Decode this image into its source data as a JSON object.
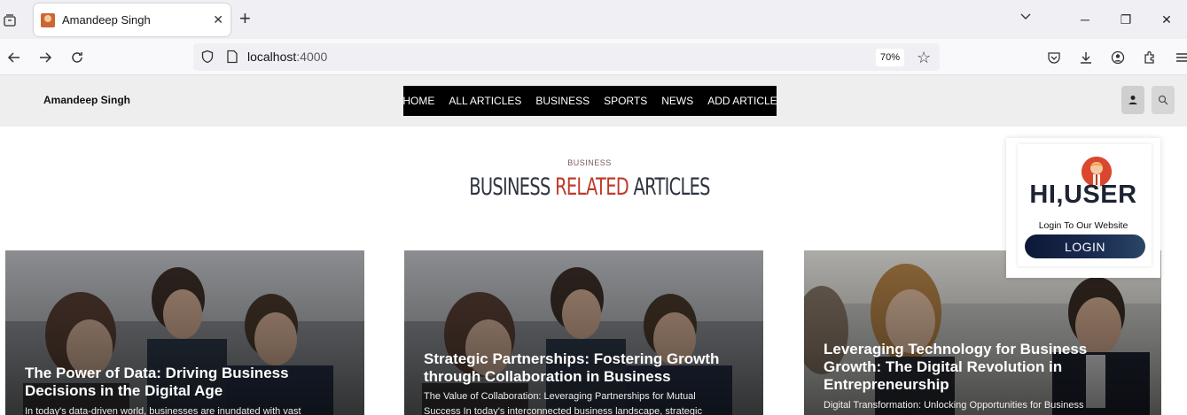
{
  "browser": {
    "tab_title": "Amandeep Singh",
    "url_host": "localhost",
    "url_port": ":4000",
    "zoom": "70%"
  },
  "site": {
    "brand": "Amandeep Singh",
    "nav": [
      "HOME",
      "ALL ARTICLES",
      "BUSINESS",
      "SPORTS",
      "NEWS",
      "ADD ARTICLE"
    ]
  },
  "section": {
    "kicker": "BUSINESS",
    "title_part1": "BUSINESS",
    "title_accent": "RELATED",
    "title_part2": "ARTICLES"
  },
  "cards": [
    {
      "title": "The Power of Data: Driving Business Decisions in the Digital Age",
      "excerpt": "In today's data-driven world, businesses are inundated with vast"
    },
    {
      "title": "Strategic Partnerships: Fostering Growth through Collaboration in Business",
      "excerpt": "The Value of Collaboration: Leveraging Partnerships for Mutual Success In today's interconnected business landscape, strategic"
    },
    {
      "title": "Leveraging Technology for Business Growth: The Digital Revolution in Entrepreneurship",
      "excerpt": "Digital Transformation: Unlocking Opportunities for Business"
    }
  ],
  "popup": {
    "greeting": "HI,USER",
    "subtitle": "Login To Our Website",
    "button": "LOGIN"
  },
  "colors": {
    "accent": "#c0392b",
    "nav_bg": "#000000",
    "header_bg": "#eeeeee",
    "login_btn": "#0d1836"
  }
}
